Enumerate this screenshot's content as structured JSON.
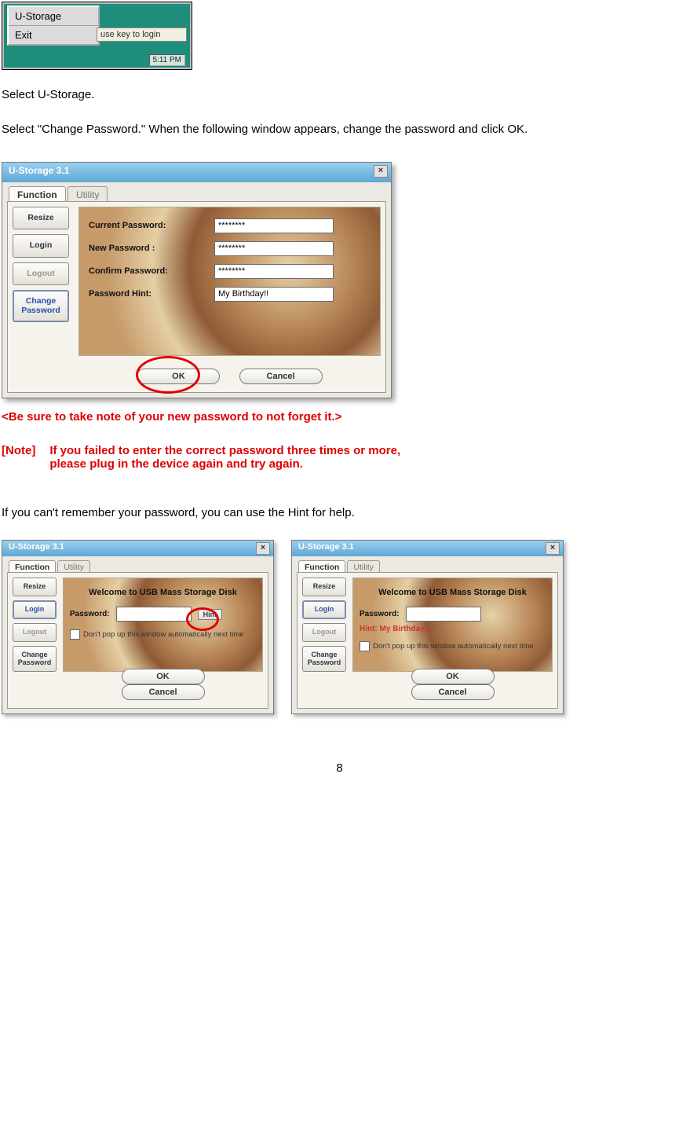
{
  "tray": {
    "menu_item_1": "U-Storage",
    "menu_item_2": "Exit",
    "tooltip": "use key to login",
    "clock": "5:11 PM"
  },
  "text": {
    "p1": "Select U-Storage.",
    "p2": "Select \"Change Password.\" When the following window appears, change the password and click OK.",
    "warn": "<Be sure to take note of your new password to not forget it.>",
    "note_label": "[Note]",
    "note_body_1": "If you failed to enter the correct password three times or more,",
    "note_body_2": "please plug in the device again and try again.",
    "p3": "If you can't remember your password, you can use the Hint for help.",
    "page_number": "8"
  },
  "app": {
    "title": "U-Storage 3.1",
    "tab_function": "Function",
    "tab_utility": "Utility",
    "side": {
      "resize": "Resize",
      "login": "Login",
      "logout": "Logout",
      "change_password": "Change Password"
    },
    "labels": {
      "current_password": "Current Password:",
      "new_password": "New Password :",
      "confirm_password": "Confirm Password:",
      "password_hint": "Password Hint:"
    },
    "values": {
      "current_password": "********",
      "new_password": "********",
      "confirm_password": "********",
      "password_hint": "My Birthday!!"
    },
    "ok": "OK",
    "cancel": "Cancel"
  },
  "mini": {
    "welcome": "Welcome to USB Mass Storage Disk",
    "password_label": "Password:",
    "hint_btn": "Hint",
    "hint_text": "Hint: My Birthday!!",
    "checkbox_label": "Don't pop up this window automatically next time",
    "ok": "OK",
    "cancel": "Cancel"
  }
}
